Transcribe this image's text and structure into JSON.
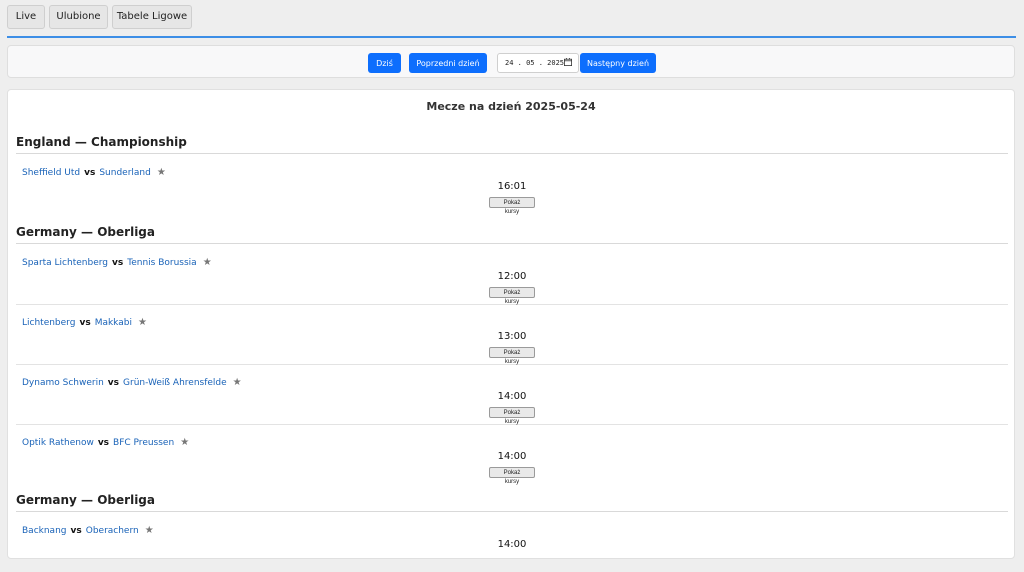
{
  "nav": {
    "tabs": [
      {
        "label": "Live"
      },
      {
        "label": "Ulubione"
      },
      {
        "label": "Tabele Ligowe"
      }
    ]
  },
  "date_nav": {
    "today_label": "Dziś",
    "prev_label": "Poprzedni dzień",
    "date_value": "24 . 05 . 2025",
    "next_label": "Następny dzień"
  },
  "colors": {
    "accent": "#0d6efd",
    "link": "#1a63b8",
    "divider": "#3d8ee6"
  },
  "main": {
    "title": "Mecze na dzień 2025-05-24",
    "leagues": [
      {
        "name": "England — Championship",
        "matches": [
          {
            "home": "Sheffield Utd",
            "away": "Sunderland",
            "time": "16:01"
          }
        ]
      },
      {
        "name": "Germany — Oberliga",
        "matches": [
          {
            "home": "Sparta Lichtenberg",
            "away": "Tennis Borussia",
            "time": "12:00"
          },
          {
            "home": "Lichtenberg",
            "away": "Makkabi",
            "time": "13:00"
          },
          {
            "home": "Dynamo Schwerin",
            "away": "Grün-Weiß Ahrensfelde",
            "time": "14:00"
          },
          {
            "home": "Optik Rathenow",
            "away": "BFC Preussen",
            "time": "14:00"
          }
        ]
      },
      {
        "name": "Germany — Oberliga",
        "matches": [
          {
            "home": "Backnang",
            "away": "Oberachern",
            "time": "14:00"
          }
        ]
      }
    ],
    "vs_label": "vs",
    "star_glyph": "★",
    "odds_label": "Pokaż kursy"
  }
}
